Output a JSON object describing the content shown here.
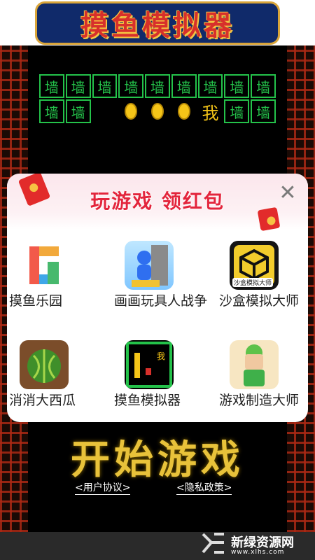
{
  "title_banner": {
    "text": "摸鱼模拟器"
  },
  "maze": {
    "tile_char": "墙",
    "player_char": "我"
  },
  "modal": {
    "title": "玩游戏 领红包",
    "close_icon": "close-icon",
    "games": [
      {
        "name": "摸鱼乐园",
        "icon": "puzzle-logo-icon"
      },
      {
        "name": "画画玩具人战争",
        "icon": "blue-figure-icon"
      },
      {
        "name": "沙盒模拟大师",
        "icon": "sandbox-cube-icon",
        "thumb_label": "沙盒模拟大师"
      },
      {
        "name": "消消大西瓜",
        "icon": "watermelon-icon"
      },
      {
        "name": "摸鱼模拟器",
        "icon": "maze-game-icon",
        "thumb_label": "我"
      },
      {
        "name": "游戏制造大师",
        "icon": "green-character-icon"
      }
    ]
  },
  "start": {
    "label": "开始游戏"
  },
  "links": {
    "user_agreement": "<用户协议>",
    "privacy_policy": "<隐私政策>"
  },
  "brand": {
    "name": "新绿资源网",
    "url": "www.xlhs.com"
  },
  "colors": {
    "accent_red": "#e3253c",
    "maze_green": "#24c24a",
    "gold": "#e8c23a"
  }
}
